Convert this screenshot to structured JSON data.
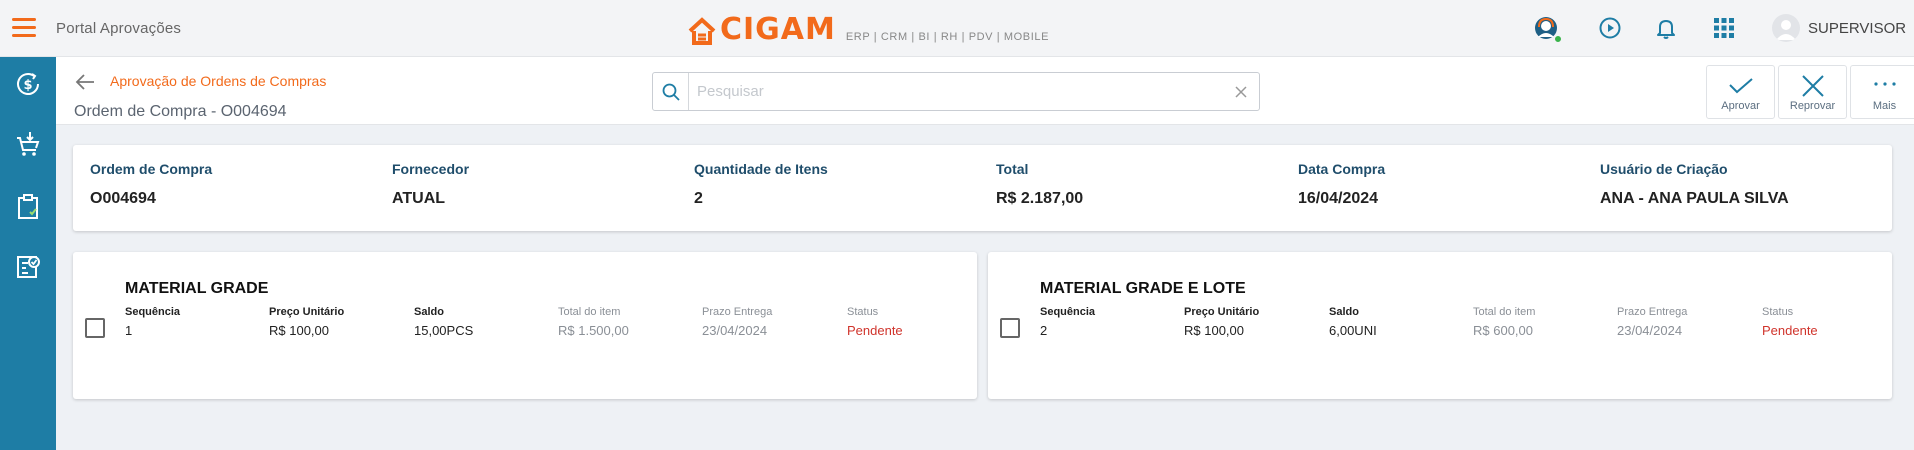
{
  "app": {
    "title": "Portal Aprovações",
    "brand": "CIGAM",
    "brand_tagline": "ERP | CRM | BI | RH | PDV | MOBILE",
    "accent_color": "#f26a1b",
    "sidebar_color": "#1e7da5"
  },
  "topbar": {
    "icons": [
      "support-icon",
      "play-circle-icon",
      "bell-icon",
      "apps-grid-icon"
    ],
    "user_name": "SUPERVISOR"
  },
  "sidebar": {
    "items": [
      "money-icon",
      "cart-download-icon",
      "clipboard-check-icon",
      "document-approve-icon"
    ]
  },
  "header": {
    "breadcrumb": "Aprovação de Ordens de Compras",
    "page_title": "Ordem de Compra - O004694",
    "search_placeholder": "Pesquisar",
    "search_value": "",
    "actions": {
      "approve": "Aprovar",
      "reject": "Reprovar",
      "more": "Mais"
    }
  },
  "summary": {
    "fields": [
      {
        "label": "Ordem de Compra",
        "value": "O004694"
      },
      {
        "label": "Fornecedor",
        "value": "ATUAL"
      },
      {
        "label": "Quantidade de Itens",
        "value": "2"
      },
      {
        "label": "Total",
        "value": "R$ 2.187,00"
      },
      {
        "label": "Data Compra",
        "value": "16/04/2024"
      },
      {
        "label": "Usuário de Criação",
        "value": "ANA - ANA PAULA SILVA"
      }
    ]
  },
  "items": [
    {
      "title": "MATERIAL GRADE",
      "checked": false,
      "fields": [
        {
          "label": "Sequência",
          "value": "1"
        },
        {
          "label": "Preço Unitário",
          "value": "R$ 100,00"
        },
        {
          "label": "Saldo",
          "value": "15,00PCS"
        },
        {
          "label": "Total do item",
          "value": "R$ 1.500,00"
        },
        {
          "label": "Prazo Entrega",
          "value": "23/04/2024"
        },
        {
          "label": "Status",
          "value": "Pendente"
        }
      ]
    },
    {
      "title": "MATERIAL GRADE E LOTE",
      "checked": false,
      "fields": [
        {
          "label": "Sequência",
          "value": "2"
        },
        {
          "label": "Preço Unitário",
          "value": "R$ 100,00"
        },
        {
          "label": "Saldo",
          "value": "6,00UNI"
        },
        {
          "label": "Total do item",
          "value": "R$ 600,00"
        },
        {
          "label": "Prazo Entrega",
          "value": "23/04/2024"
        },
        {
          "label": "Status",
          "value": "Pendente"
        }
      ]
    }
  ]
}
